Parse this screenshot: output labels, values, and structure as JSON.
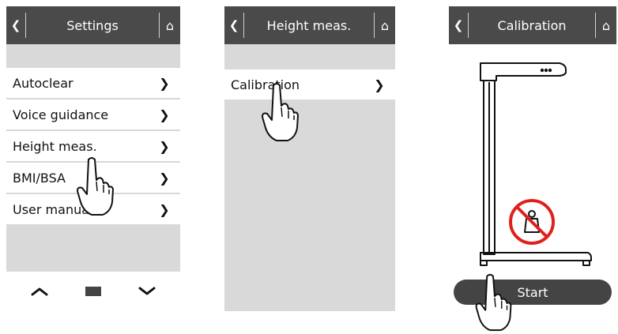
{
  "screens": {
    "settings": {
      "title": "Settings",
      "items": [
        {
          "label": "Autoclear"
        },
        {
          "label": "Voice guidance"
        },
        {
          "label": "Height meas."
        },
        {
          "label": "BMI/BSA"
        },
        {
          "label": "User manual"
        }
      ],
      "chevron": "❯",
      "nav": {
        "up": "︿",
        "down": "﹀"
      }
    },
    "height": {
      "title": "Height meas.",
      "items": [
        {
          "label": "Calibration"
        }
      ],
      "chevron": "❯"
    },
    "calibration": {
      "title": "Calibration",
      "start_label": "Start"
    }
  },
  "icons": {
    "back": "❮",
    "home": "⌂"
  },
  "colors": {
    "header": "#4a4a4a",
    "screen_bg": "#d9d9d9",
    "button_dark": "#444444",
    "prohibit_red": "#e0201b"
  }
}
